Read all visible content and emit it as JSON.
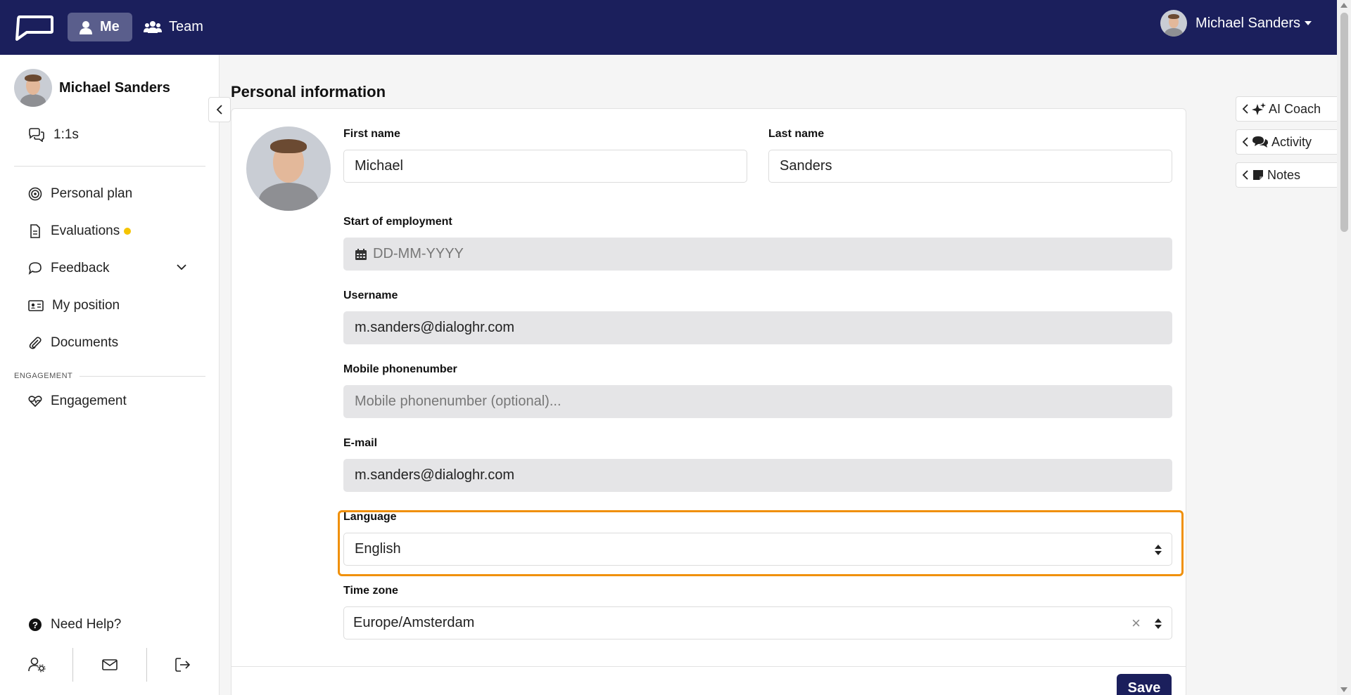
{
  "nav": {
    "me_label": "Me",
    "team_label": "Team",
    "user_name": "Michael Sanders"
  },
  "sidebar": {
    "profile_name": "Michael Sanders",
    "items": [
      {
        "label": "1:1s",
        "icon": "chat-icon"
      },
      {
        "label": "Personal plan",
        "icon": "target-icon"
      },
      {
        "label": "Evaluations",
        "icon": "document-icon"
      },
      {
        "label": "Feedback",
        "icon": "comment-icon"
      },
      {
        "label": "My position",
        "icon": "id-card-icon"
      },
      {
        "label": "Documents",
        "icon": "paperclip-icon"
      },
      {
        "label": "Engagement",
        "icon": "heart-pulse-icon"
      },
      {
        "label": "Need Help?",
        "icon": "question-icon"
      }
    ],
    "section_engagement": "ENGAGEMENT"
  },
  "main": {
    "title": "Personal information",
    "first_name_label": "First name",
    "first_name_value": "Michael",
    "last_name_label": "Last name",
    "last_name_value": "Sanders",
    "start_label": "Start of employment",
    "start_placeholder": "DD-MM-YYYY",
    "username_label": "Username",
    "username_value": "m.sanders@dialoghr.com",
    "mobile_label": "Mobile phonenumber",
    "mobile_placeholder": "Mobile phonenumber (optional)...",
    "email_label": "E-mail",
    "email_value": "m.sanders@dialoghr.com",
    "language_label": "Language",
    "language_value": "English",
    "timezone_label": "Time zone",
    "timezone_value": "Europe/Amsterdam",
    "save_label": "Save"
  },
  "right_tabs": {
    "ai_coach": "AI Coach",
    "activity": "Activity",
    "notes": "Notes"
  },
  "colors": {
    "nav_bg": "#1b1f5c",
    "highlight": "#f0900a",
    "badge": "#f5c400"
  }
}
